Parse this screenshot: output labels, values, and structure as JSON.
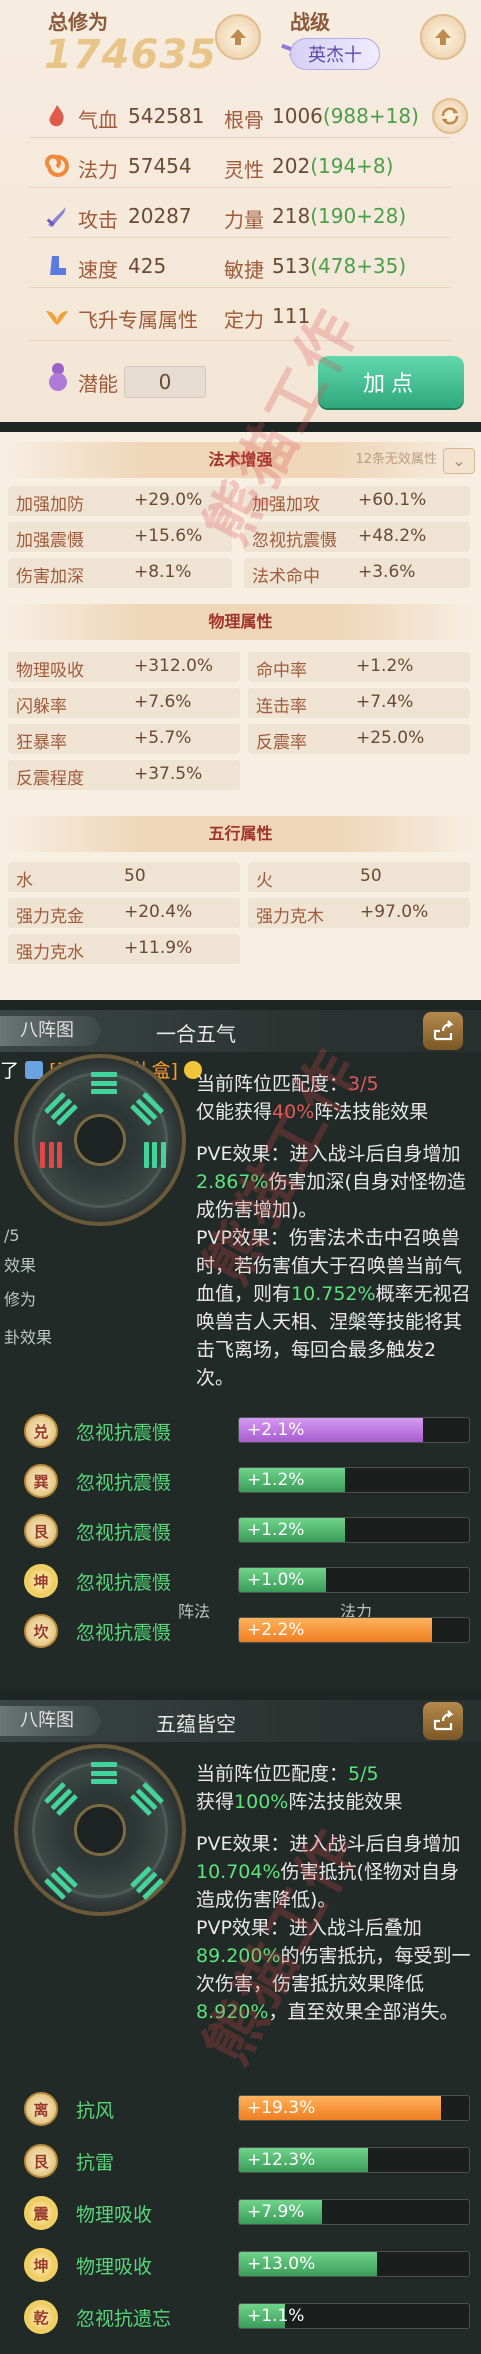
{
  "stats": {
    "total_label": "总修为",
    "total_value": "174635",
    "rank_label": "战级",
    "rank_value": "英杰十",
    "rows": [
      {
        "left_key": "气血",
        "left_val": "542581",
        "right_key": "根骨",
        "right_val": "1006",
        "right_bonus": "(988+18)"
      },
      {
        "left_key": "法力",
        "left_val": "57454",
        "right_key": "灵性",
        "right_val": "202",
        "right_bonus": "(194+8)"
      },
      {
        "left_key": "攻击",
        "left_val": "20287",
        "right_key": "力量",
        "right_val": "218",
        "right_bonus": "(190+28)"
      },
      {
        "left_key": "速度",
        "left_val": "425",
        "right_key": "敏捷",
        "right_val": "513",
        "right_bonus": "(478+35)"
      },
      {
        "left_key": "飞升专属属性",
        "left_val": "",
        "right_key": "定力",
        "right_val": "111",
        "right_bonus": ""
      }
    ],
    "potential_label": "潜能",
    "potential_value": "0",
    "add_point_label": "加点"
  },
  "attrs": {
    "spell_title": "法术增强",
    "spell_hint": "12条无效属性",
    "spell": [
      {
        "k": "加强加防",
        "v": "+29.0%"
      },
      {
        "k": "加强加攻",
        "v": "+60.1%"
      },
      {
        "k": "加强震慑",
        "v": "+15.6%"
      },
      {
        "k": "忽视抗震慑",
        "v": "+48.2%"
      },
      {
        "k": "伤害加深",
        "v": "+8.1%"
      },
      {
        "k": "法术命中",
        "v": "+3.6%"
      }
    ],
    "phys_title": "物理属性",
    "phys": [
      {
        "k": "物理吸收",
        "v": "+312.0%"
      },
      {
        "k": "命中率",
        "v": "+1.2%"
      },
      {
        "k": "闪躲率",
        "v": "+7.6%"
      },
      {
        "k": "连击率",
        "v": "+7.4%"
      },
      {
        "k": "狂暴率",
        "v": "+5.7%"
      },
      {
        "k": "反震率",
        "v": "+25.0%"
      },
      {
        "k": "反震程度",
        "v": "+37.5%"
      }
    ],
    "five_title": "五行属性",
    "five": [
      {
        "k": "水",
        "v": "50"
      },
      {
        "k": "火",
        "v": "50"
      },
      {
        "k": "强力克金",
        "v": "+20.4%"
      },
      {
        "k": "强力克木",
        "v": "+97.0%"
      },
      {
        "k": "强力克水",
        "v": "+11.9%"
      }
    ]
  },
  "formation1": {
    "tab": "八阵图",
    "name": "一合五气",
    "chat_prefix": "了",
    "chat_link": "[天狼星破礼盒]",
    "match_label": "当前阵位匹配度：",
    "match_value": "3/5",
    "effect_a": "仅能获得",
    "effect_pct": "40%",
    "effect_b": "阵法技能效果",
    "pve_a": "PVE效果：进入战斗后自身增加",
    "pve_val": "2.867%",
    "pve_b": "伤害加深(自身对怪物造成伤害增加)。",
    "pvp_a": "PVP效果：伤害法术击中召唤兽时，若伤害值大于召唤兽当前气血值，则有",
    "pvp_val": "10.752%",
    "pvp_b": "概率无视召唤兽吉人天相、涅槃等技能将其击飞离场，每回合最多触发2次。",
    "bg_a": "/5",
    "bg_b": "效果",
    "bg_c": "修为",
    "bg_d": "卦效果",
    "bg_e": "阵法",
    "bg_f": "法力",
    "rows": [
      {
        "medal": "兑",
        "big": false,
        "name": "忽视抗震慑",
        "val": "+2.1%",
        "pct": 80,
        "color": "purple"
      },
      {
        "medal": "巽",
        "big": false,
        "name": "忽视抗震慑",
        "val": "+1.2%",
        "pct": 46,
        "color": "green"
      },
      {
        "medal": "艮",
        "big": false,
        "name": "忽视抗震慑",
        "val": "+1.2%",
        "pct": 46,
        "color": "green"
      },
      {
        "medal": "坤",
        "big": true,
        "name": "忽视抗震慑",
        "val": "+1.0%",
        "pct": 38,
        "color": "green"
      },
      {
        "medal": "坎",
        "big": false,
        "name": "忽视抗震慑",
        "val": "+2.2%",
        "pct": 84,
        "color": "orange"
      }
    ]
  },
  "formation2": {
    "tab": "八阵图",
    "name": "五蕴皆空",
    "match_label": "当前阵位匹配度：",
    "match_value": "5/5",
    "effect_a": "获得",
    "effect_pct": "100%",
    "effect_b": "阵法技能效果",
    "pve_a": "PVE效果：进入战斗后自身增加",
    "pve_val": "10.704%",
    "pve_b": "伤害抵抗(怪物对自身造成伤害降低)。",
    "pvp_a": "PVP效果：进入战斗后叠加",
    "pvp_val": "89.200%",
    "pvp_b": "的伤害抵抗，每受到一次伤害，伤害抵抗效果降低",
    "pvp_val2": "8.920%",
    "pvp_c": "，直至效果全部消失。",
    "rows": [
      {
        "medal": "离",
        "big": false,
        "name": "抗风",
        "val": "+19.3%",
        "pct": 88,
        "color": "orange"
      },
      {
        "medal": "艮",
        "big": false,
        "name": "抗雷",
        "val": "+12.3%",
        "pct": 56,
        "color": "green"
      },
      {
        "medal": "震",
        "big": true,
        "name": "物理吸收",
        "val": "+7.9%",
        "pct": 36,
        "color": "green"
      },
      {
        "medal": "坤",
        "big": true,
        "name": "物理吸收",
        "val": "+13.0%",
        "pct": 60,
        "color": "green"
      },
      {
        "medal": "乾",
        "big": true,
        "name": "忽视抗遗忘",
        "val": "+1.1%",
        "pct": 20,
        "color": "green"
      }
    ]
  },
  "watermark": "熊猫工作"
}
